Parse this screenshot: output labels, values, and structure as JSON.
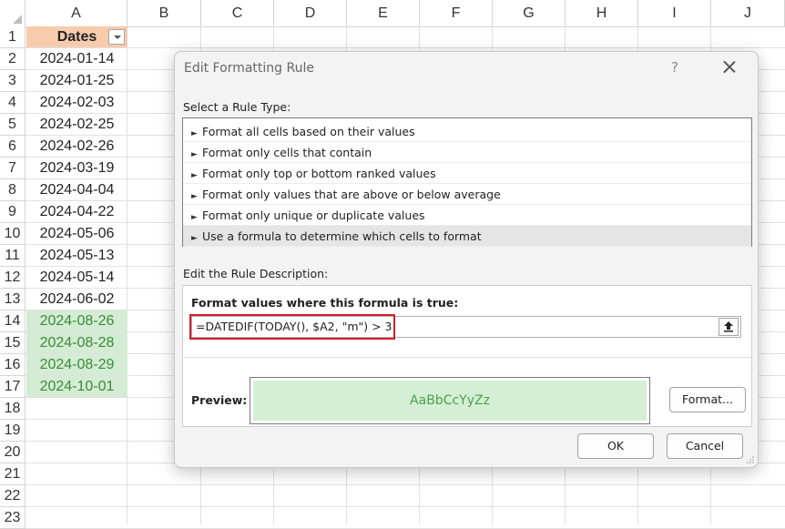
{
  "sheet": {
    "columns": [
      "A",
      "B",
      "C",
      "D",
      "E",
      "F",
      "G",
      "H",
      "I",
      "J"
    ],
    "rows": [
      "1",
      "2",
      "3",
      "4",
      "5",
      "6",
      "7",
      "8",
      "9",
      "10",
      "11",
      "12",
      "13",
      "14",
      "15",
      "16",
      "17",
      "18",
      "19",
      "20",
      "21",
      "22",
      "23"
    ],
    "header_label": "Dates",
    "dates": [
      "2024-01-14",
      "2024-01-25",
      "2024-02-03",
      "2024-02-25",
      "2024-02-26",
      "2024-03-19",
      "2024-04-04",
      "2024-04-22",
      "2024-05-06",
      "2024-05-13",
      "2024-05-14",
      "2024-06-02",
      "2024-08-26",
      "2024-08-28",
      "2024-08-29",
      "2024-10-01"
    ],
    "highlight_from_index": 12,
    "header_fill": "#f8cbad",
    "highlight_fill": "#d3ecd3",
    "highlight_text": "#3c8a3c"
  },
  "dialog": {
    "title": "Edit Formatting Rule",
    "help": "?",
    "select_rule_label": "Select a Rule Type:",
    "rule_types": [
      "Format all cells based on their values",
      "Format only cells that contain",
      "Format only top or bottom ranked values",
      "Format only values that are above or below average",
      "Format only unique or duplicate values",
      "Use a formula to determine which cells to format"
    ],
    "selected_rule_index": 5,
    "edit_desc_label": "Edit the Rule Description:",
    "formula_heading": "Format values where this formula is true:",
    "formula": "=DATEDIF(TODAY(), $A2, \"m\") > 3",
    "preview_label": "Preview:",
    "preview_text": "AaBbCcYyZz",
    "format_button": "Format...",
    "ok_button": "OK",
    "cancel_button": "Cancel",
    "highlight_color": "#d21f2a"
  }
}
